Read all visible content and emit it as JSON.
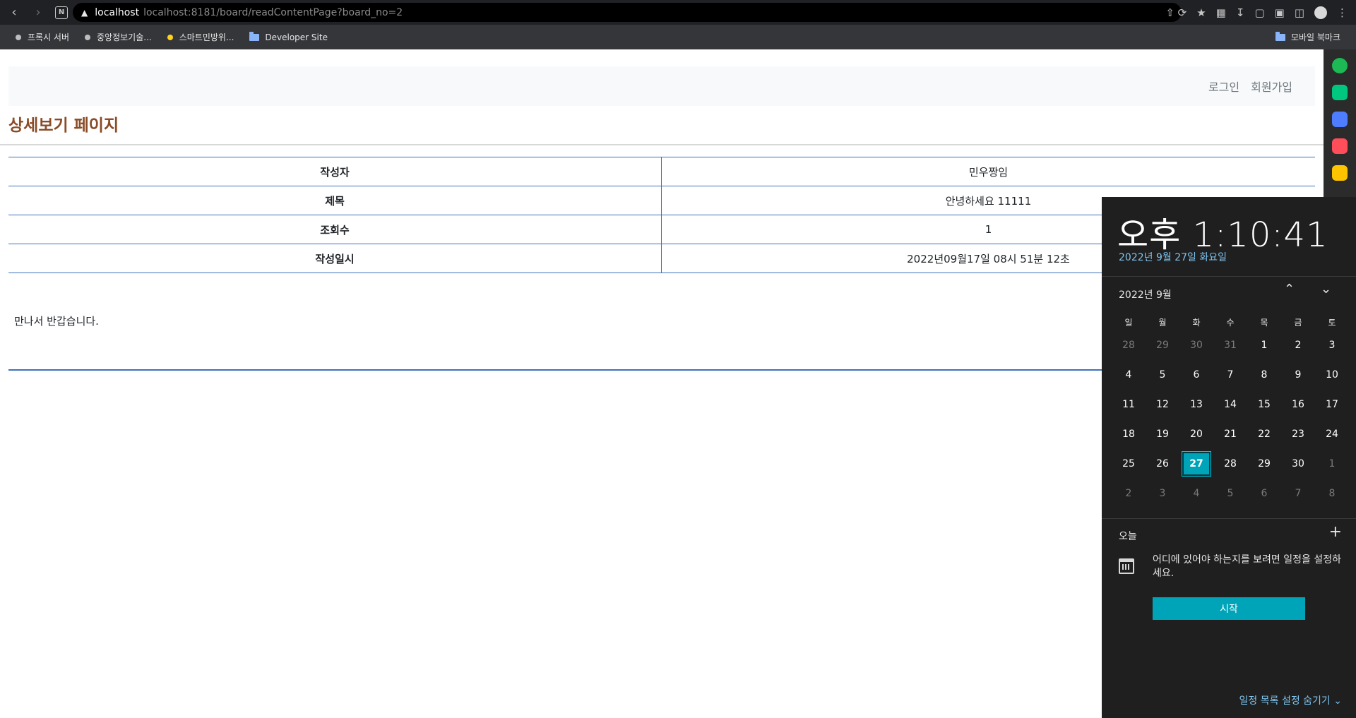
{
  "browser": {
    "url_host": "localhost",
    "url_full": "localhost:8181/board/readContentPage?board_no=2"
  },
  "bookmarks": {
    "items": [
      {
        "label": "프록시 서버",
        "kind": "dot"
      },
      {
        "label": "중앙정보기술...",
        "kind": "dot"
      },
      {
        "label": "스마트민방위...",
        "kind": "dot-yellow"
      },
      {
        "label": "Developer Site",
        "kind": "folder"
      }
    ],
    "right": {
      "label": "모바일 북마크"
    }
  },
  "navbar": {
    "login": "로그인",
    "signup": "회원가입"
  },
  "page": {
    "title": "상세보기 페이지",
    "rows": [
      {
        "label": "작성자",
        "value": "민우짱임"
      },
      {
        "label": "제목",
        "value": "안녕하세요 11111"
      },
      {
        "label": "조회수",
        "value": "1"
      },
      {
        "label": "작성일시",
        "value": "2022년09월17일 08시 51분 12초"
      }
    ],
    "body": "만나서 반갑습니다."
  },
  "flyout": {
    "clock": "오후 1:10:41",
    "date": "2022년 9월 27일 화요일",
    "month": "2022년 9월",
    "weekdays": [
      "일",
      "월",
      "화",
      "수",
      "목",
      "금",
      "토"
    ],
    "weeks": [
      [
        "28",
        "29",
        "30",
        "31",
        "1",
        "2",
        "3"
      ],
      [
        "4",
        "5",
        "6",
        "7",
        "8",
        "9",
        "10"
      ],
      [
        "11",
        "12",
        "13",
        "14",
        "15",
        "16",
        "17"
      ],
      [
        "18",
        "19",
        "20",
        "21",
        "22",
        "23",
        "24"
      ],
      [
        "25",
        "26",
        "27",
        "28",
        "29",
        "30",
        "1"
      ],
      [
        "2",
        "3",
        "4",
        "5",
        "6",
        "7",
        "8"
      ]
    ],
    "today": "27",
    "agenda_title": "오늘",
    "agenda_msg": "어디에 있어야 하는지를 보려면 일정을 설정하세요.",
    "start_button": "시작",
    "hide_link": "일정 목록 설정 숨기기"
  },
  "colors": {
    "title": "#8a4b26",
    "table_border": "#3b73b9",
    "accent": "#00a4b8",
    "date_blue": "#7fc4ef"
  }
}
